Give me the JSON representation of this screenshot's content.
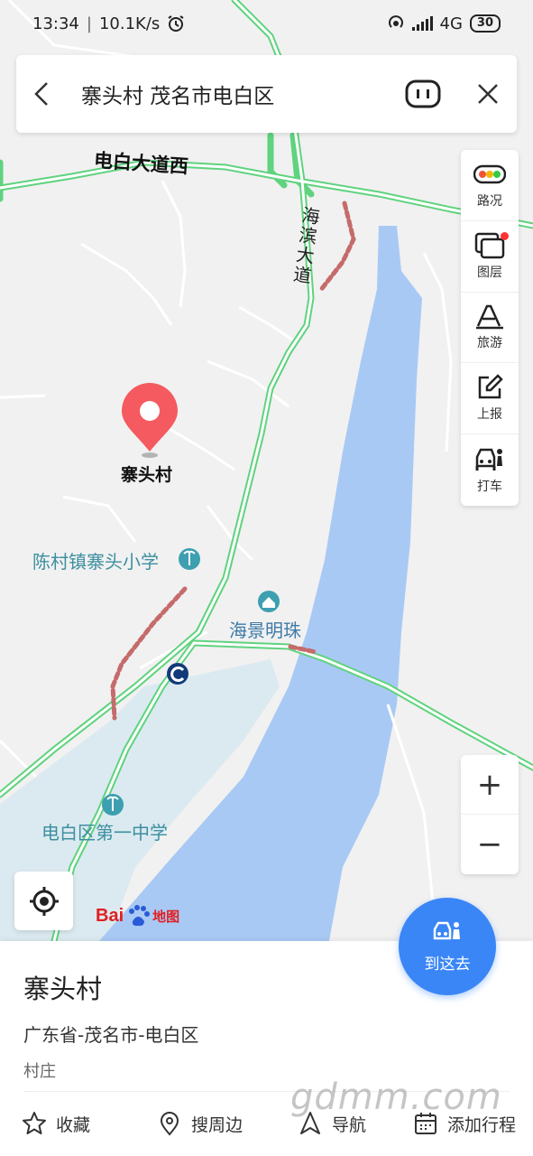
{
  "status_bar": {
    "time": "13:34",
    "speed": "10.1K/s",
    "network": "4G",
    "battery": "30"
  },
  "search": {
    "title": "寨头村 茂名市电白区"
  },
  "map": {
    "labels": {
      "road_dianbai": "电白大道西",
      "road_haibin": "海滨大道",
      "pin_label": "寨头村",
      "school_primary": "陈村镇寨头小学",
      "estate": "海景明珠",
      "school_middle": "电白区第一中学"
    },
    "logo_text_1": "Bai",
    "logo_text_2": "地图",
    "colors": {
      "water": "#a9c9f5",
      "road": "#5fd37e",
      "pin": "#f45a5f",
      "school_label": "#3d8fa0"
    }
  },
  "tools": [
    {
      "label": "路况",
      "icon": "traffic-light-icon"
    },
    {
      "label": "图层",
      "icon": "layers-icon"
    },
    {
      "label": "旅游",
      "icon": "travel-icon"
    },
    {
      "label": "上报",
      "icon": "report-edit-icon"
    },
    {
      "label": "打车",
      "icon": "taxi-icon"
    }
  ],
  "zoom": {
    "in": "+",
    "out": "−"
  },
  "go_here": {
    "label": "到这去"
  },
  "place": {
    "name": "寨头村",
    "address": "广东省-茂名市-电白区",
    "type": "村庄"
  },
  "actions": [
    {
      "label": "收藏",
      "icon": "star-icon"
    },
    {
      "label": "搜周边",
      "icon": "location-pin-icon"
    },
    {
      "label": "导航",
      "icon": "navigation-arrow-icon"
    },
    {
      "label": "添加行程",
      "icon": "calendar-icon"
    }
  ],
  "watermark": "gdmm.com"
}
